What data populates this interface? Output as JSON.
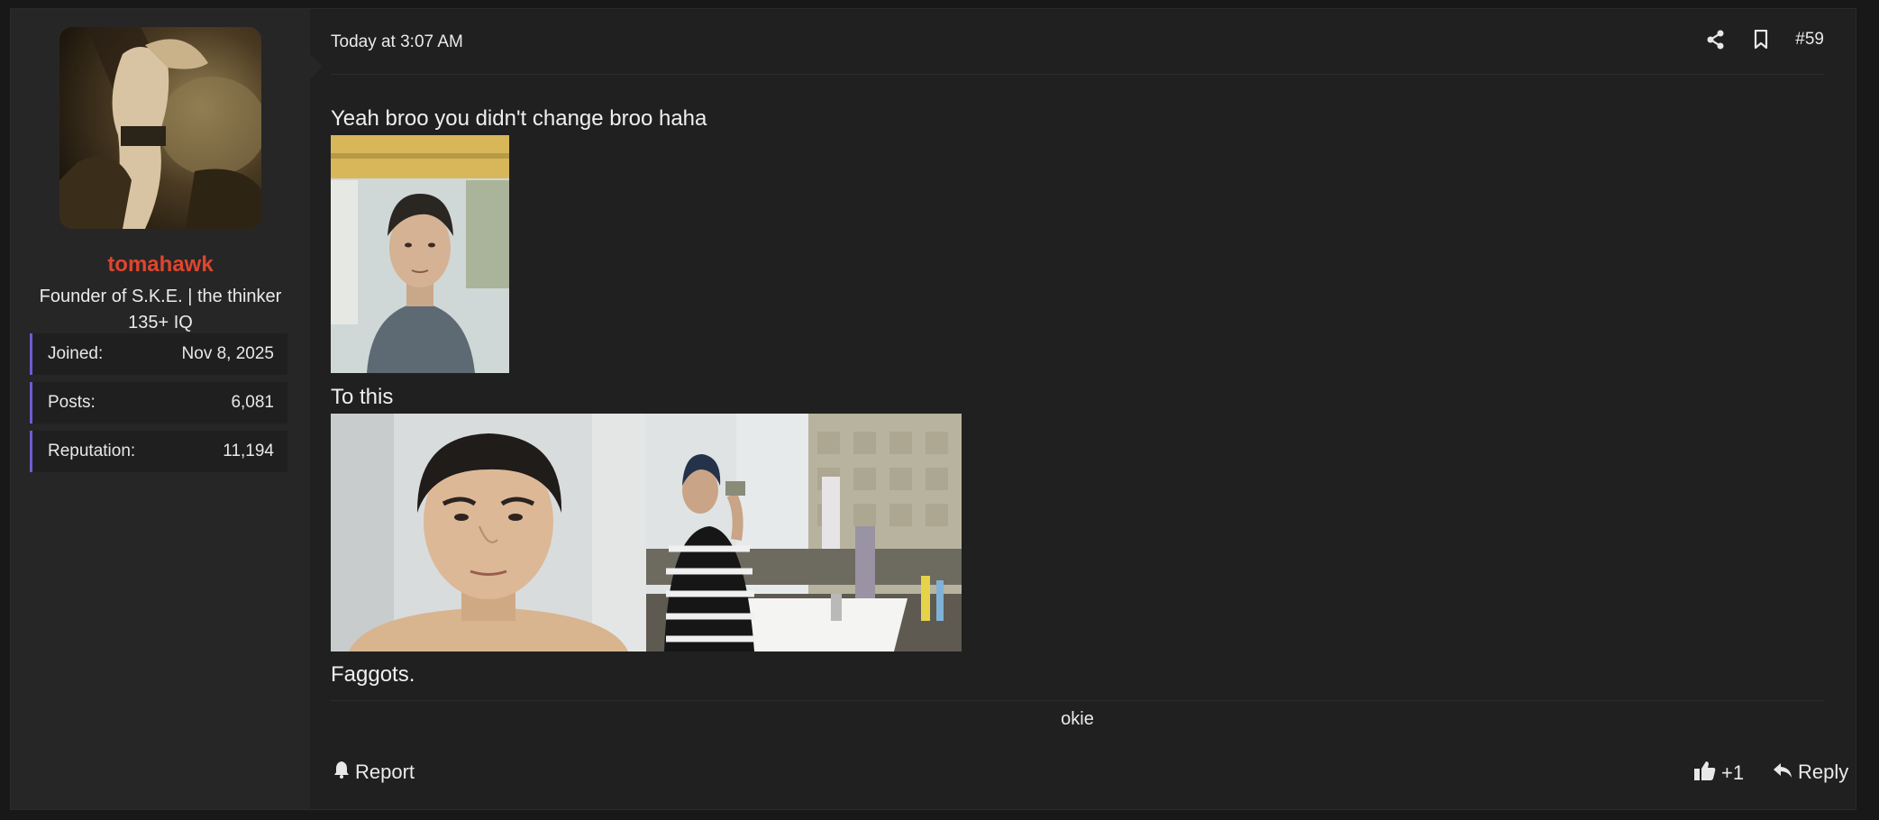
{
  "user": {
    "name": "tomahawk",
    "title_line1": "Founder of S.K.E. | the thinker",
    "title_line2": "135+ IQ",
    "stats": [
      {
        "label": "Joined:",
        "value": "Nov 8, 2025"
      },
      {
        "label": "Posts:",
        "value": "6,081"
      },
      {
        "label": "Reputation:",
        "value": "11,194"
      }
    ]
  },
  "post": {
    "date": "Today at 3:07 AM",
    "number": "#59",
    "line1": "Yeah broo you didn't change broo haha",
    "line2": "To this",
    "line3": "Faggots.",
    "signature": "okie"
  },
  "actions": {
    "report": "Report",
    "like_count": "+1",
    "reply": "Reply"
  },
  "icons": [
    "share-icon",
    "bookmark-icon",
    "bell-icon",
    "thumbs-up-icon",
    "reply-icon"
  ],
  "colors": {
    "accent": "#6f5bd6",
    "username": "#e0452e"
  }
}
